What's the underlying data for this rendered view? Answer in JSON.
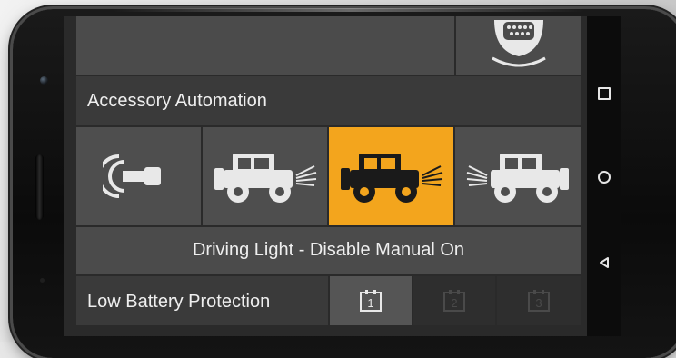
{
  "app": {
    "accessory_section": {
      "title": "Accessory Automation",
      "modes": [
        {
          "id": "ignition",
          "icon": "ignition-key-icon",
          "active": false
        },
        {
          "id": "vehicle-lights",
          "icon": "vehicle-lights-icon",
          "active": false
        },
        {
          "id": "vehicle-lights-active",
          "icon": "vehicle-lights-icon",
          "active": true
        },
        {
          "id": "vehicle-lights-back",
          "icon": "vehicle-rear-lights-icon",
          "active": false
        }
      ],
      "status_text": "Driving Light - Disable Manual On"
    },
    "battery_section": {
      "title": "Low Battery Protection",
      "levels": [
        {
          "label": "1",
          "active": true
        },
        {
          "label": "2",
          "active": false
        },
        {
          "label": "3",
          "active": false
        }
      ]
    },
    "colors": {
      "accent": "#f3a51d",
      "tile": "#4e4e4e",
      "background": "#2a2a2a"
    }
  },
  "system_nav": {
    "recent_icon": "square-icon",
    "home_icon": "circle-icon",
    "back_icon": "triangle-back-icon"
  }
}
